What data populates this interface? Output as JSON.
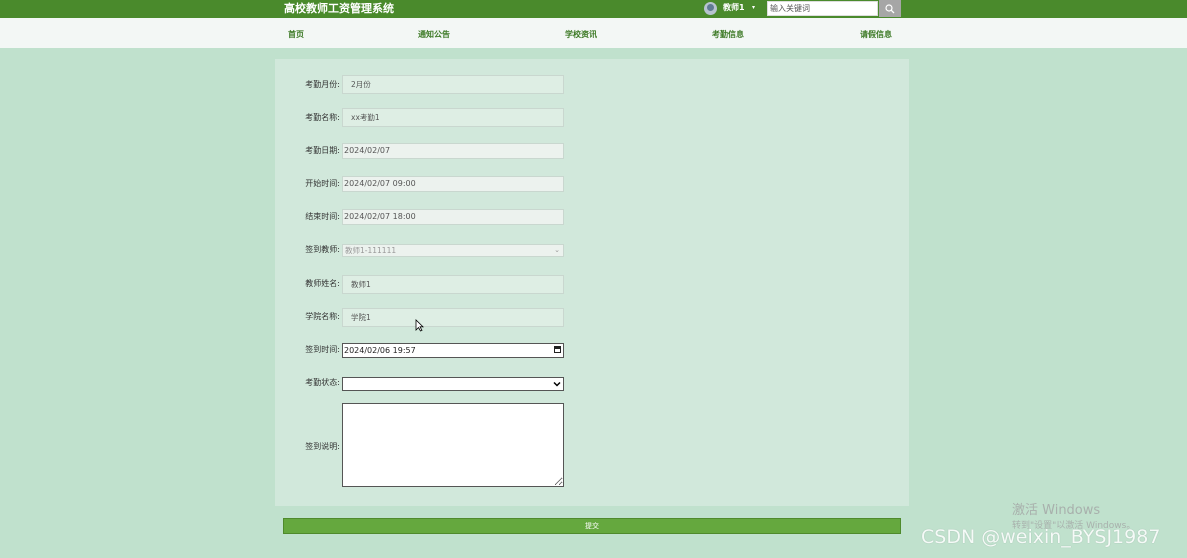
{
  "header": {
    "app_title": "高校教师工资管理系统",
    "user_name": "教师1",
    "user_caret": "▾",
    "search_placeholder": "输入关键词"
  },
  "nav": {
    "items": [
      {
        "label": "首页"
      },
      {
        "label": "通知公告"
      },
      {
        "label": "学校资讯"
      },
      {
        "label": "考勤信息"
      },
      {
        "label": "请假信息"
      }
    ]
  },
  "form": {
    "fields": [
      {
        "label": "考勤月份:",
        "value": "2月份"
      },
      {
        "label": "考勤名称:",
        "value": "xx考勤1"
      },
      {
        "label": "考勤日期:",
        "value": "2024/02/07"
      },
      {
        "label": "开始时间:",
        "value": "2024/02/07 09:00"
      },
      {
        "label": "结束时间:",
        "value": "2024/02/07 18:00"
      },
      {
        "label": "签到教师:",
        "value": "教师1-111111"
      },
      {
        "label": "教师姓名:",
        "value": "教师1"
      },
      {
        "label": "学院名称:",
        "value": "学院1"
      },
      {
        "label": "签到时间:",
        "value": "2024/02/06 19:57"
      },
      {
        "label": "考勤状态:",
        "value": ""
      },
      {
        "label": "签到说明:",
        "value": ""
      }
    ],
    "submit_label": "提交"
  },
  "overlay": {
    "activate_title": "激活 Windows",
    "activate_sub": "转到\"设置\"以激活 Windows。",
    "csdn_watermark": "CSDN @weixin_BYSJ1987"
  },
  "colors": {
    "topbar": "#4a8a2c",
    "background": "#c0e1cd",
    "panel": "#d1e8db",
    "submit": "#65a83e",
    "nav_text": "#3d7a26"
  }
}
